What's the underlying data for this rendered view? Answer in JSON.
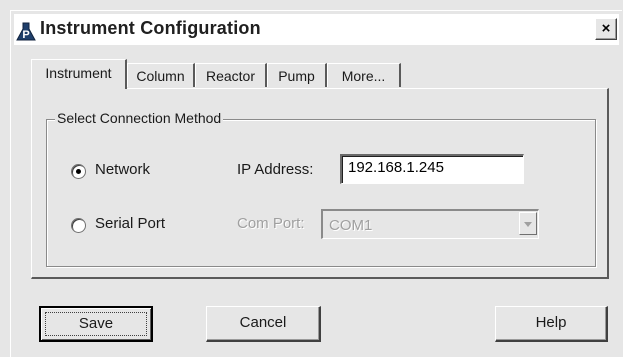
{
  "window": {
    "title": "Instrument Configuration",
    "close_label": "×",
    "app_icon": "flask-p-icon"
  },
  "tabs": [
    {
      "label": "Instrument",
      "active": true
    },
    {
      "label": "Column",
      "active": false
    },
    {
      "label": "Reactor",
      "active": false
    },
    {
      "label": "Pump",
      "active": false
    },
    {
      "label": "More...",
      "active": false
    }
  ],
  "connection": {
    "group_title": "Select Connection Method",
    "network_label": "Network",
    "serial_label": "Serial Port",
    "selected": "Network",
    "ip_label": "IP Address:",
    "ip_value": "192.168.1.245",
    "com_label": "Com Port:",
    "com_value": "COM1"
  },
  "buttons": {
    "save": "Save",
    "cancel": "Cancel",
    "help": "Help"
  }
}
